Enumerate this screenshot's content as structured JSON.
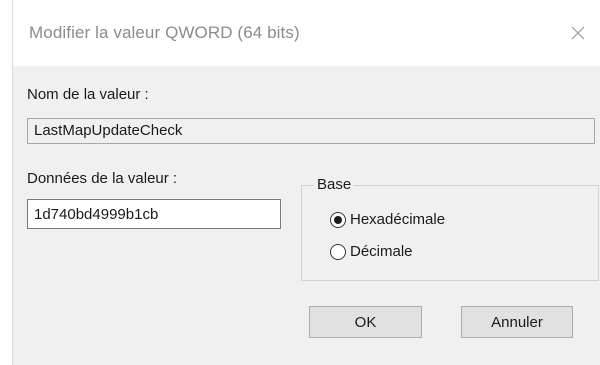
{
  "dialog": {
    "title": "Modifier la valeur QWORD (64 bits)",
    "close_icon": "close-icon"
  },
  "value_name": {
    "label": "Nom de la valeur :",
    "value": "LastMapUpdateCheck"
  },
  "value_data": {
    "label": "Données de la valeur :",
    "value": "1d740bd4999b1cb"
  },
  "base": {
    "legend": "Base",
    "options": [
      {
        "label": "Hexadécimale",
        "selected": true
      },
      {
        "label": "Décimale",
        "selected": false
      }
    ]
  },
  "buttons": {
    "ok": "OK",
    "cancel": "Annuler"
  }
}
